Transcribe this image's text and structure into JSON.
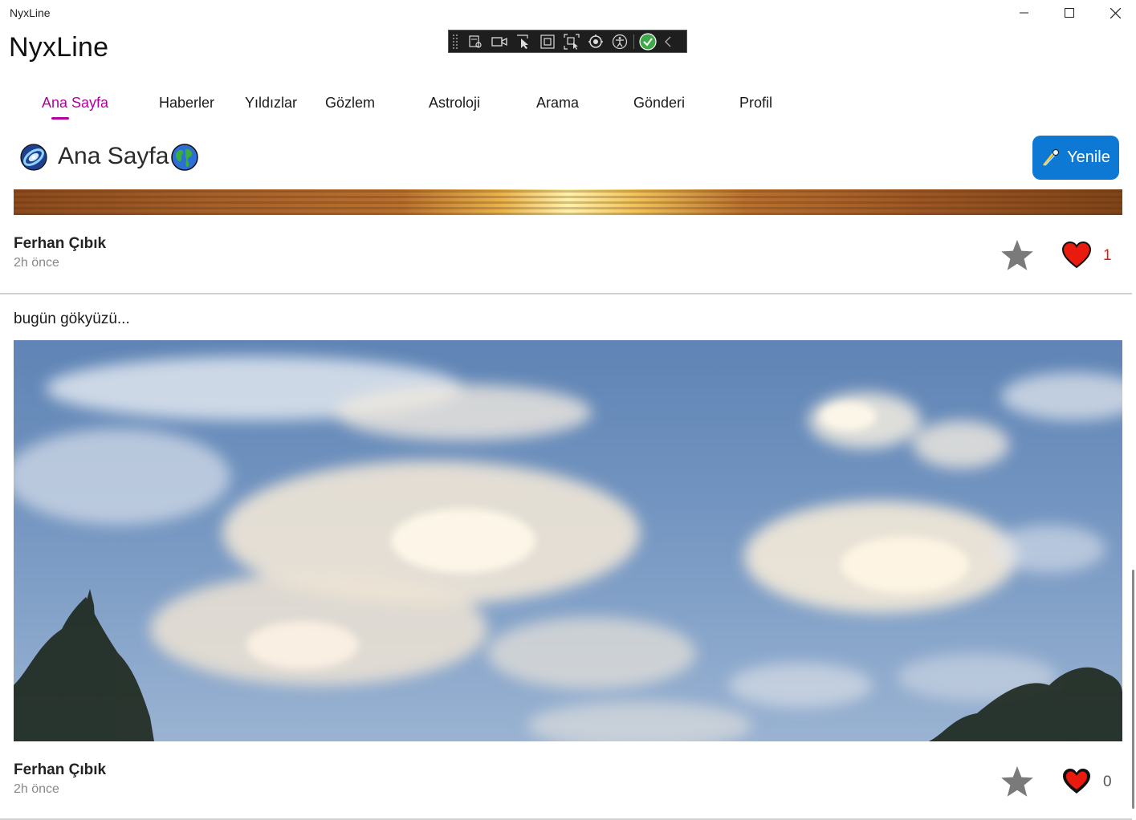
{
  "window": {
    "title": "NyxLine"
  },
  "app": {
    "title": "NyxLine"
  },
  "nav": {
    "tabs": [
      {
        "label": "Ana Sayfa",
        "active": true
      },
      {
        "label": "Haberler"
      },
      {
        "label": "Yıldızlar"
      },
      {
        "label": "Gözlem"
      },
      {
        "label": "Astroloji"
      },
      {
        "label": "Arama"
      },
      {
        "label": "Gönderi"
      },
      {
        "label": "Profil"
      }
    ]
  },
  "page": {
    "title": "Ana Sayfa",
    "refresh_label": "Yenile",
    "icons": [
      "galaxy-icon",
      "globe-icon",
      "comet-icon"
    ]
  },
  "posts": [
    {
      "author": "Ferhan Çıbık",
      "time": "2h önce",
      "likes": "1",
      "liked": true
    },
    {
      "caption": "bugün gökyüzü...",
      "author": "Ferhan Çıbık",
      "time": "2h önce",
      "likes": "0",
      "liked": false
    }
  ],
  "colors": {
    "accent": "#b4009e",
    "button": "#0e78d5",
    "like_active": "#e81b0e",
    "star": "#7a7a7a"
  }
}
